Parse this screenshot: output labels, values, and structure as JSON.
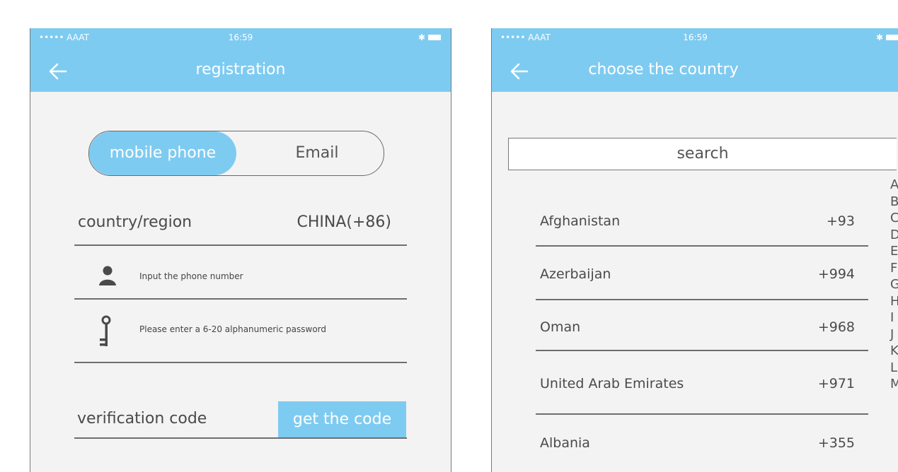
{
  "registration_screen": {
    "status": {
      "carrier": "•••••  AAAT",
      "time": "16:59"
    },
    "title": "registration",
    "tabs": {
      "mobile": "mobile phone",
      "email": "Email"
    },
    "country": {
      "label": "country/region",
      "value": "CHINA(+86)"
    },
    "phone_placeholder": "Input the phone number",
    "password_placeholder": "Please enter a 6-20 alphanumeric password",
    "verification_label": "verification code",
    "get_code_label": "get the code"
  },
  "country_screen": {
    "status": {
      "carrier": "•••••  AAAT",
      "time": "16:59"
    },
    "title": "choose the country",
    "search_placeholder": "search",
    "countries": [
      {
        "name": "Afghanistan",
        "code": "+93"
      },
      {
        "name": "Azerbaijan",
        "code": "+994"
      },
      {
        "name": "Oman",
        "code": "+968"
      },
      {
        "name": "United Arab Emirates",
        "code": "+971"
      },
      {
        "name": "Albania",
        "code": "+355"
      }
    ],
    "index_letters": [
      "A",
      "B",
      "C",
      "D",
      "E",
      "F",
      "G",
      "H",
      "I",
      "J",
      "K",
      "L",
      "M"
    ]
  },
  "colors": {
    "accent": "#7ecbf1",
    "background": "#f3f3f3",
    "line": "#6e6e6e"
  },
  "icons": [
    "back-arrow-icon",
    "wifi-icon",
    "bluetooth-icon",
    "battery-icon",
    "user-icon",
    "key-icon"
  ]
}
